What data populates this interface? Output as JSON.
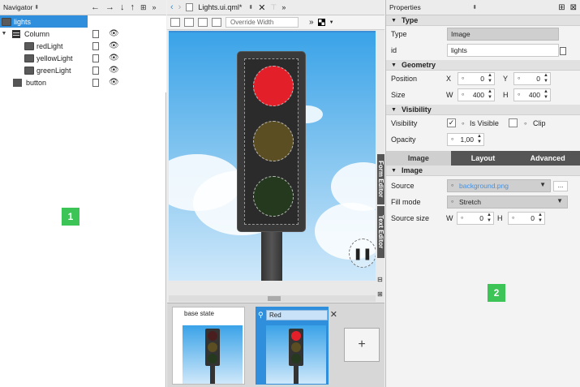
{
  "navigator": {
    "title": "Navigator",
    "items": [
      {
        "label": "lights",
        "indent": 0
      },
      {
        "label": "Column",
        "indent": 1
      },
      {
        "label": "redLight",
        "indent": 2
      },
      {
        "label": "yellowLight",
        "indent": 2
      },
      {
        "label": "greenLight",
        "indent": 2
      },
      {
        "label": "button",
        "indent": 1
      }
    ],
    "badge": "1"
  },
  "editor": {
    "file_name": "Lights.ui.qml*",
    "override_width_placeholder": "Override Width",
    "side_tabs": [
      "Form Editor",
      "Text Editor"
    ],
    "states": [
      {
        "label": "base state"
      },
      {
        "label": "Red"
      }
    ],
    "add_state_label": "+"
  },
  "properties": {
    "title": "Properties",
    "type_section": "Type",
    "type_label": "Type",
    "type_value": "Image",
    "id_label": "id",
    "id_value": "lights",
    "geometry_section": "Geometry",
    "position_label": "Position",
    "x_label": "X",
    "x_value": "0",
    "y_label": "Y",
    "y_value": "0",
    "size_label": "Size",
    "w_label": "W",
    "w_value": "400",
    "h_label": "H",
    "h_value": "400",
    "visibility_section": "Visibility",
    "visibility_label": "Visibility",
    "is_visible_label": "Is Visible",
    "is_visible_checked": "✓",
    "clip_label": "Clip",
    "opacity_label": "Opacity",
    "opacity_value": "1,00",
    "tabs": [
      "Image",
      "Layout",
      "Advanced"
    ],
    "image_section": "Image",
    "source_label": "Source",
    "source_value": "background.png",
    "browse_label": "...",
    "fill_mode_label": "Fill mode",
    "fill_mode_value": "Stretch",
    "source_size_label": "Source size",
    "ss_w_label": "W",
    "ss_w_value": "0",
    "ss_h_label": "H",
    "ss_h_value": "0",
    "badge": "2"
  },
  "colors": {
    "selection": "#2f8fdc",
    "badge": "#3dc457",
    "red_lamp": "#e3202a",
    "dim_yellow": "#5b4e22",
    "dim_green": "#25391f"
  }
}
